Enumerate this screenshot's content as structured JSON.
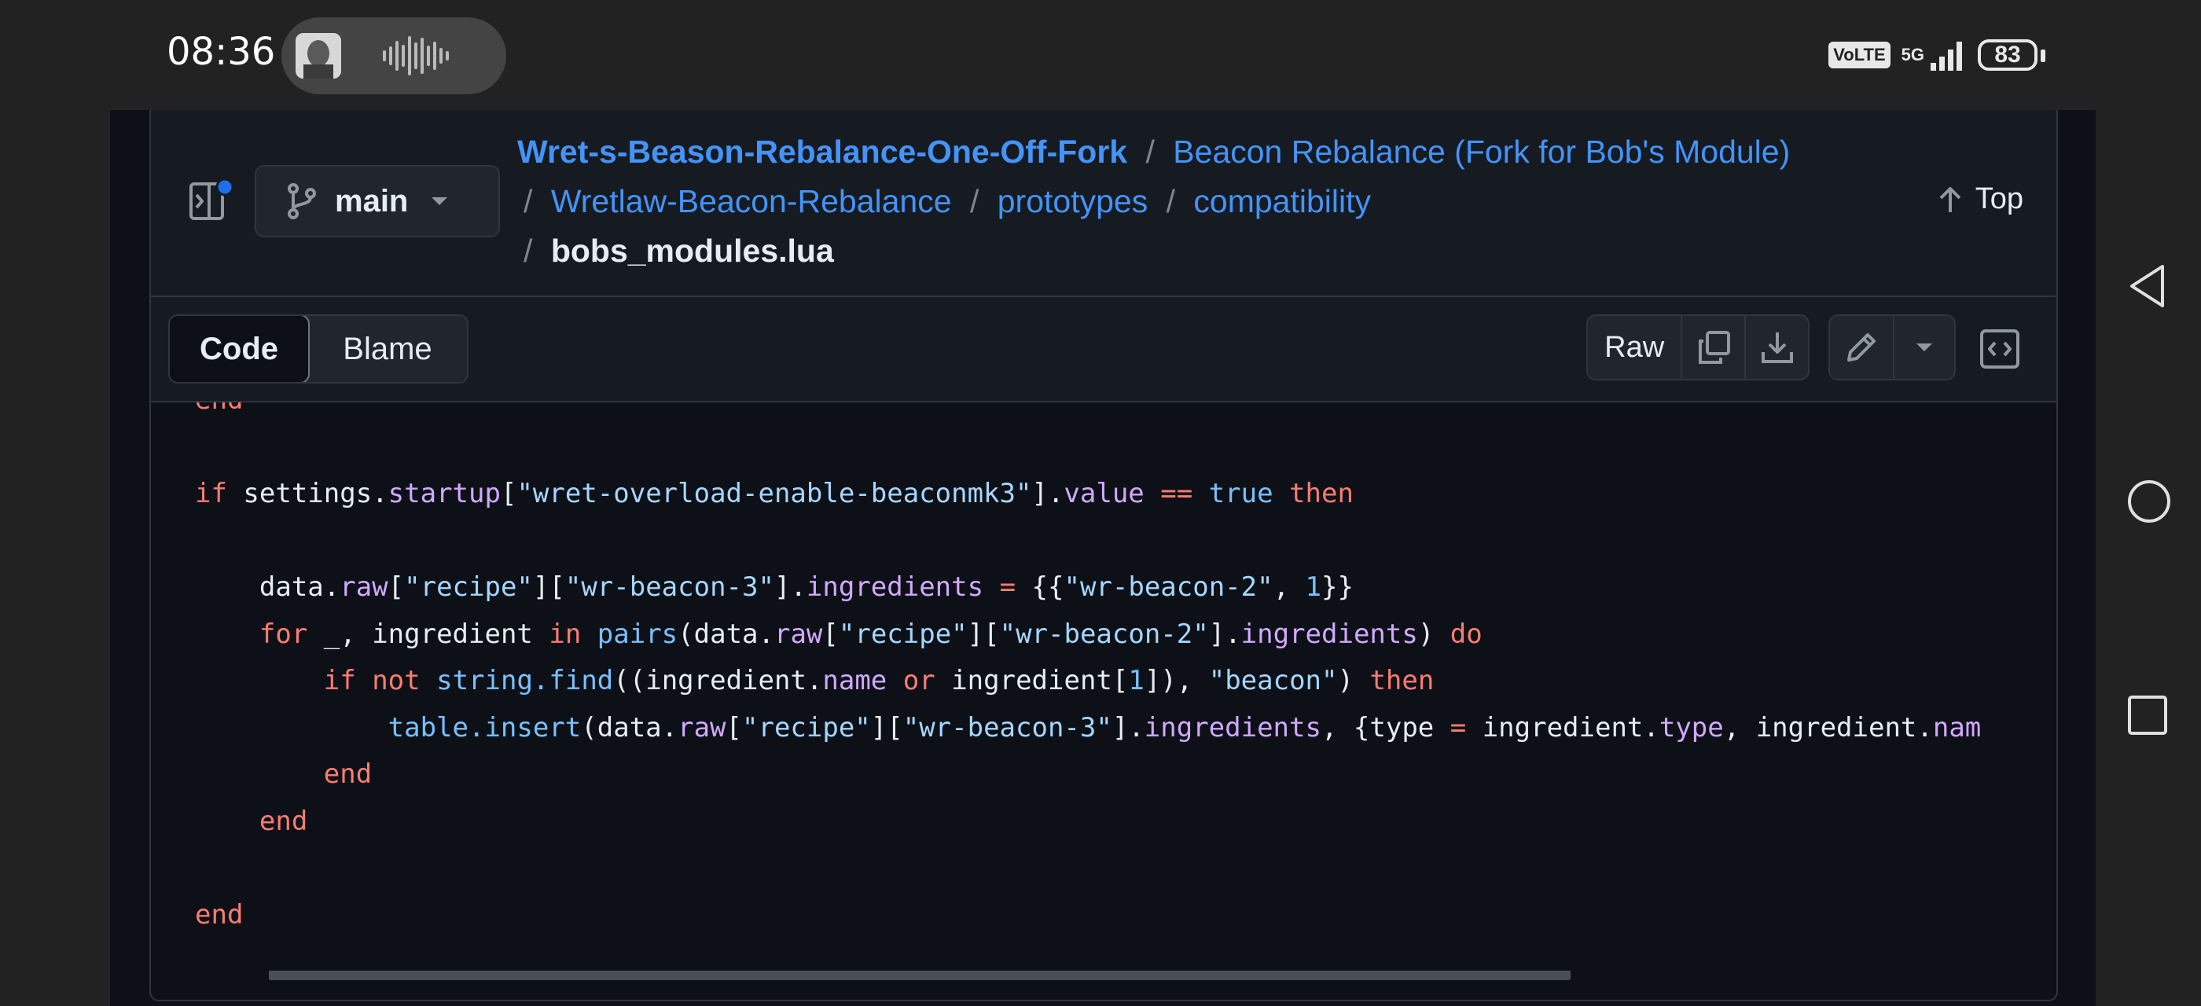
{
  "status_bar": {
    "time": "08:36",
    "volte": "VoLTE",
    "network": "5G",
    "battery": "83"
  },
  "header": {
    "branch": "main",
    "breadcrumb": {
      "repo": "Wret-s-Beason-Rebalance-One-Off-Fork",
      "folders": [
        "Beacon Rebalance (Fork for Bob's Module)",
        "Wretlaw-Beacon-Rebalance",
        "prototypes",
        "compatibility"
      ],
      "file": "bobs_modules.lua",
      "separator": "/"
    },
    "top_label": "Top"
  },
  "toolbar": {
    "code_tab": "Code",
    "blame_tab": "Blame",
    "raw_label": "Raw"
  },
  "code": {
    "lines": [
      [
        {
          "t": "end",
          "c": "kw"
        }
      ],
      [],
      [
        {
          "t": "if",
          "c": "kw"
        },
        {
          "t": " settings."
        },
        {
          "t": "startup",
          "c": "fn"
        },
        {
          "t": "["
        },
        {
          "t": "\"wret-overload-enable-beaconmk3\"",
          "c": "str"
        },
        {
          "t": "]."
        },
        {
          "t": "value",
          "c": "fn"
        },
        {
          "t": " "
        },
        {
          "t": "==",
          "c": "op"
        },
        {
          "t": " "
        },
        {
          "t": "true",
          "c": "bi"
        },
        {
          "t": " "
        },
        {
          "t": "then",
          "c": "kw"
        }
      ],
      [],
      [
        {
          "t": "    data."
        },
        {
          "t": "raw",
          "c": "fn"
        },
        {
          "t": "["
        },
        {
          "t": "\"recipe\"",
          "c": "str"
        },
        {
          "t": "]["
        },
        {
          "t": "\"wr-beacon-3\"",
          "c": "str"
        },
        {
          "t": "]."
        },
        {
          "t": "ingredients",
          "c": "fn"
        },
        {
          "t": " "
        },
        {
          "t": "=",
          "c": "op"
        },
        {
          "t": " {{"
        },
        {
          "t": "\"wr-beacon-2\"",
          "c": "str"
        },
        {
          "t": ", "
        },
        {
          "t": "1",
          "c": "num"
        },
        {
          "t": "}}"
        }
      ],
      [
        {
          "t": "    "
        },
        {
          "t": "for",
          "c": "kw"
        },
        {
          "t": " _, ingredient "
        },
        {
          "t": "in",
          "c": "kw"
        },
        {
          "t": " "
        },
        {
          "t": "pairs",
          "c": "bi"
        },
        {
          "t": "(data."
        },
        {
          "t": "raw",
          "c": "fn"
        },
        {
          "t": "["
        },
        {
          "t": "\"recipe\"",
          "c": "str"
        },
        {
          "t": "]["
        },
        {
          "t": "\"wr-beacon-2\"",
          "c": "str"
        },
        {
          "t": "]."
        },
        {
          "t": "ingredients",
          "c": "fn"
        },
        {
          "t": ") "
        },
        {
          "t": "do",
          "c": "kw"
        }
      ],
      [
        {
          "t": "        "
        },
        {
          "t": "if",
          "c": "kw"
        },
        {
          "t": " "
        },
        {
          "t": "not",
          "c": "kw"
        },
        {
          "t": " "
        },
        {
          "t": "string.find",
          "c": "bi"
        },
        {
          "t": "((ingredient."
        },
        {
          "t": "name",
          "c": "fn"
        },
        {
          "t": " "
        },
        {
          "t": "or",
          "c": "kw"
        },
        {
          "t": " ingredient["
        },
        {
          "t": "1",
          "c": "num"
        },
        {
          "t": "]), "
        },
        {
          "t": "\"beacon\"",
          "c": "str"
        },
        {
          "t": ") "
        },
        {
          "t": "then",
          "c": "kw"
        }
      ],
      [
        {
          "t": "            "
        },
        {
          "t": "table.insert",
          "c": "bi"
        },
        {
          "t": "(data."
        },
        {
          "t": "raw",
          "c": "fn"
        },
        {
          "t": "["
        },
        {
          "t": "\"recipe\"",
          "c": "str"
        },
        {
          "t": "]["
        },
        {
          "t": "\"wr-beacon-3\"",
          "c": "str"
        },
        {
          "t": "]."
        },
        {
          "t": "ingredients",
          "c": "fn"
        },
        {
          "t": ", {type "
        },
        {
          "t": "=",
          "c": "op"
        },
        {
          "t": " ingredient."
        },
        {
          "t": "type",
          "c": "fn"
        },
        {
          "t": ", ingredient."
        },
        {
          "t": "nam",
          "c": "fn"
        }
      ],
      [
        {
          "t": "        "
        },
        {
          "t": "end",
          "c": "kw"
        }
      ],
      [
        {
          "t": "    "
        },
        {
          "t": "end",
          "c": "kw"
        }
      ],
      [],
      [
        {
          "t": "end",
          "c": "kw"
        }
      ]
    ]
  }
}
